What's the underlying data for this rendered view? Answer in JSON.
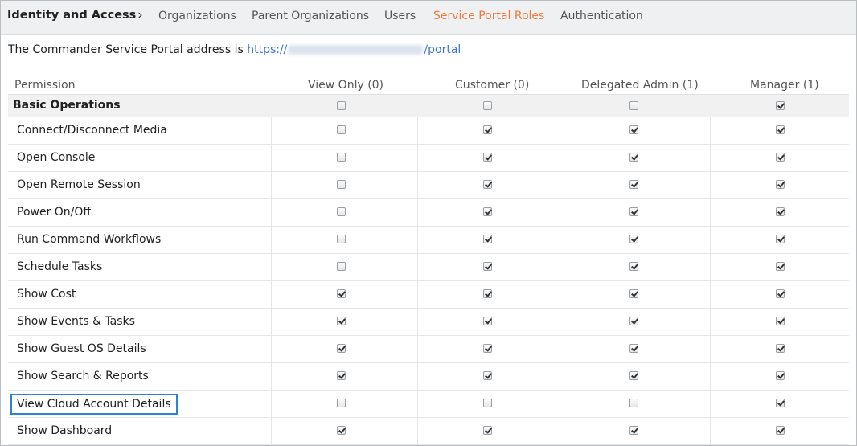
{
  "nav": {
    "root": "Identity and Access",
    "separator": "›",
    "tabs": [
      "Organizations",
      "Parent Organizations",
      "Users",
      "Service Portal Roles",
      "Authentication"
    ],
    "active_tab": "Service Portal Roles"
  },
  "portal": {
    "prefix": "The Commander Service Portal address is",
    "link_start": "https://",
    "link_end": "/portal"
  },
  "columns": [
    "Permission",
    "View Only (0)",
    "Customer (0)",
    "Delegated Admin (1)",
    "Manager (1)"
  ],
  "section": {
    "label": "Basic Operations",
    "checks": [
      false,
      false,
      false,
      true
    ]
  },
  "rows": [
    {
      "label": "Connect/Disconnect Media",
      "checks": [
        false,
        true,
        true,
        true
      ]
    },
    {
      "label": "Open Console",
      "checks": [
        false,
        true,
        true,
        true
      ]
    },
    {
      "label": "Open Remote Session",
      "checks": [
        false,
        true,
        true,
        true
      ]
    },
    {
      "label": "Power On/Off",
      "checks": [
        false,
        true,
        true,
        true
      ]
    },
    {
      "label": "Run Command Workflows",
      "checks": [
        false,
        true,
        true,
        true
      ]
    },
    {
      "label": "Schedule Tasks",
      "checks": [
        false,
        true,
        true,
        true
      ]
    },
    {
      "label": "Show Cost",
      "checks": [
        true,
        true,
        true,
        true
      ]
    },
    {
      "label": "Show Events & Tasks",
      "checks": [
        true,
        true,
        true,
        true
      ]
    },
    {
      "label": "Show Guest OS Details",
      "checks": [
        true,
        true,
        true,
        true
      ]
    },
    {
      "label": "Show Search & Reports",
      "checks": [
        true,
        true,
        true,
        true
      ]
    },
    {
      "label": "View Cloud Account Details",
      "checks": [
        false,
        false,
        false,
        true
      ],
      "focused": true
    },
    {
      "label": "Show Dashboard",
      "checks": [
        true,
        true,
        true,
        true
      ]
    }
  ]
}
